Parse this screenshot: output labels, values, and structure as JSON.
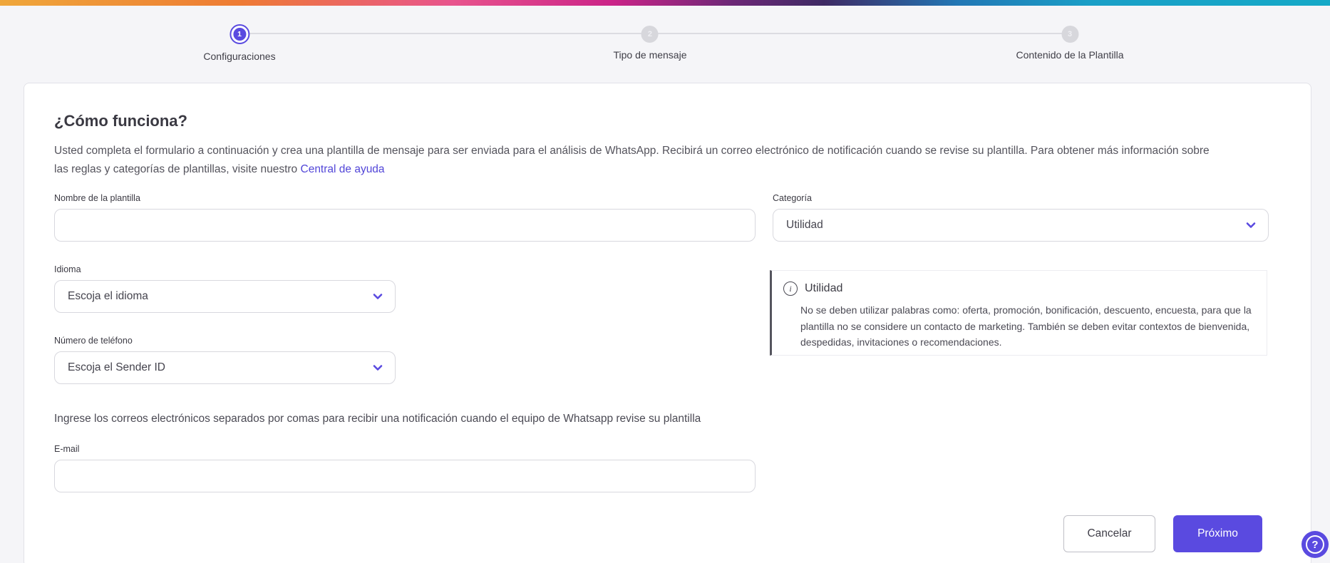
{
  "colors": {
    "accent": "#5a4ae0",
    "link": "#5246d8",
    "stepper_inactive": "#d7d7dc",
    "topbar_gradient": [
      "#efa73b",
      "#ee7b34",
      "#e8548d",
      "#cb2488",
      "#3e2a64",
      "#2277b5",
      "#15a9c7"
    ]
  },
  "stepper": {
    "steps": [
      {
        "number": "1",
        "label": "Configuraciones",
        "state": "active"
      },
      {
        "number": "2",
        "label": "Tipo de mensaje",
        "state": "inactive"
      },
      {
        "number": "3",
        "label": "Contenido de la Plantilla",
        "state": "inactive"
      }
    ]
  },
  "card": {
    "title": "¿Cómo funciona?",
    "description": "Usted completa el formulario a continuación y crea una plantilla de mensaje para ser enviada para el análisis de WhatsApp. Recibirá un correo electrónico de notificación cuando se revise su plantilla. Para obtener más información sobre las reglas y categorías de plantillas, visite nuestro",
    "help_link": "Central de ayuda",
    "fields": {
      "template_name": {
        "label": "Nombre de la plantilla",
        "value": ""
      },
      "category": {
        "label": "Categoría",
        "value": "Utilidad"
      },
      "language": {
        "label": "Idioma",
        "value": "Escoja el idioma"
      },
      "phone": {
        "label": "Número de teléfono",
        "value": "Escoja el Sender ID"
      },
      "email": {
        "label": "E-mail",
        "value": ""
      }
    },
    "info_box": {
      "icon_glyph": "i",
      "title": "Utilidad",
      "text": "No se deben utilizar palabras como: oferta, promoción, bonificación, descuento, encuesta, para que la plantilla no se considere un contacto de marketing. También se deben evitar contextos de bienvenida, despedidas, invitaciones o recomendaciones."
    },
    "email_instruction": "Ingrese los correos electrónicos separados por comas para recibir una notificación cuando el equipo de Whatsapp revise su plantilla",
    "buttons": {
      "cancel": "Cancelar",
      "next": "Próximo"
    }
  },
  "help_button": {
    "glyph": "?"
  }
}
